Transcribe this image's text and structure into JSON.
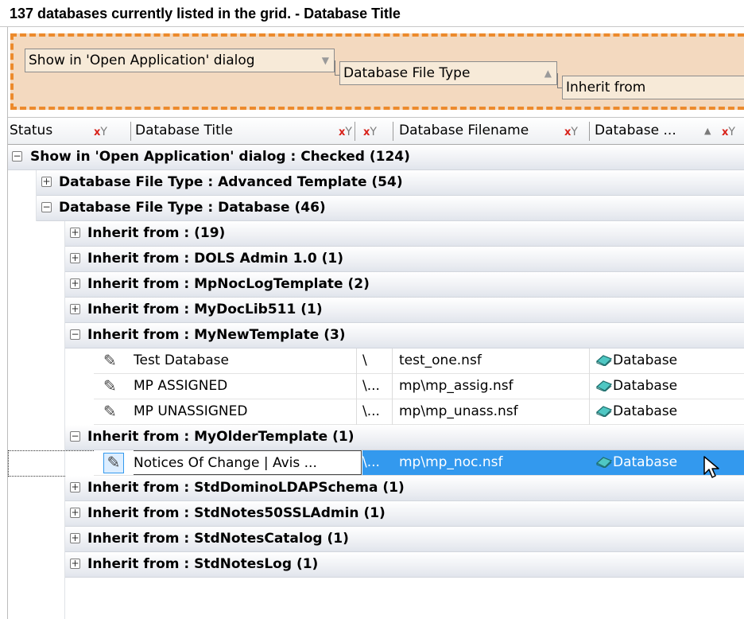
{
  "title": "137 databases currently listed in the grid. - Database Title",
  "group_panel": {
    "chips": [
      {
        "label": "Show in 'Open Application' dialog",
        "arrow": "▼"
      },
      {
        "label": "Database File Type",
        "arrow": "▲"
      },
      {
        "label": "Inherit from",
        "arrow": ""
      }
    ]
  },
  "columns": [
    {
      "label": "Status"
    },
    {
      "label": "Database Title"
    },
    {
      "label": ""
    },
    {
      "label": "Database Filename"
    },
    {
      "label": "Database ...",
      "sort": "▲"
    }
  ],
  "groups": {
    "top": "Show in 'Open Application' dialog : Checked (124)",
    "advanced_template": "Database File Type : Advanced Template (54)",
    "database": "Database File Type : Database (46)",
    "inherit_blank": "Inherit from :  (19)",
    "inherit_dols": "Inherit from : DOLS Admin 1.0 (1)",
    "inherit_mpnoclog": "Inherit from : MpNocLogTemplate (2)",
    "inherit_mydoclib": "Inherit from : MyDocLib511 (1)",
    "inherit_mynew": "Inherit from : MyNewTemplate (3)",
    "inherit_myolder": "Inherit from : MyOlderTemplate (1)",
    "inherit_stdldap": "Inherit from : StdDominoLDAPSchema (1)",
    "inherit_stdssl": "Inherit from : StdNotes50SSLAdmin (1)",
    "inherit_stdcatalog": "Inherit from : StdNotesCatalog (1)",
    "inherit_stdlog": "Inherit from : StdNotesLog (1)"
  },
  "records": [
    {
      "title": "Test Database",
      "path": "\\",
      "filename": "test_one.nsf",
      "type": "Database"
    },
    {
      "title": "MP ASSIGNED",
      "path": "\\...",
      "filename": "mp\\mp_assig.nsf",
      "type": "Database"
    },
    {
      "title": "MP UNASSIGNED",
      "path": "\\...",
      "filename": "mp\\mp_unass.nsf",
      "type": "Database"
    },
    {
      "title": "Notices Of Change | Avis ...",
      "path": "\\...",
      "filename": "mp\\mp_noc.nsf",
      "type": "Database"
    }
  ],
  "colors": {
    "group_panel_bg": "#f3d9bf",
    "group_panel_border": "#ec8a2c",
    "selection": "#3399ee"
  },
  "icons": {
    "record": "pencil-icon",
    "database": "database-book-icon",
    "filter": "clear-filter-icon",
    "collapse": "minus-box-icon",
    "expand": "plus-box-icon",
    "cursor": "mouse-pointer-icon"
  }
}
